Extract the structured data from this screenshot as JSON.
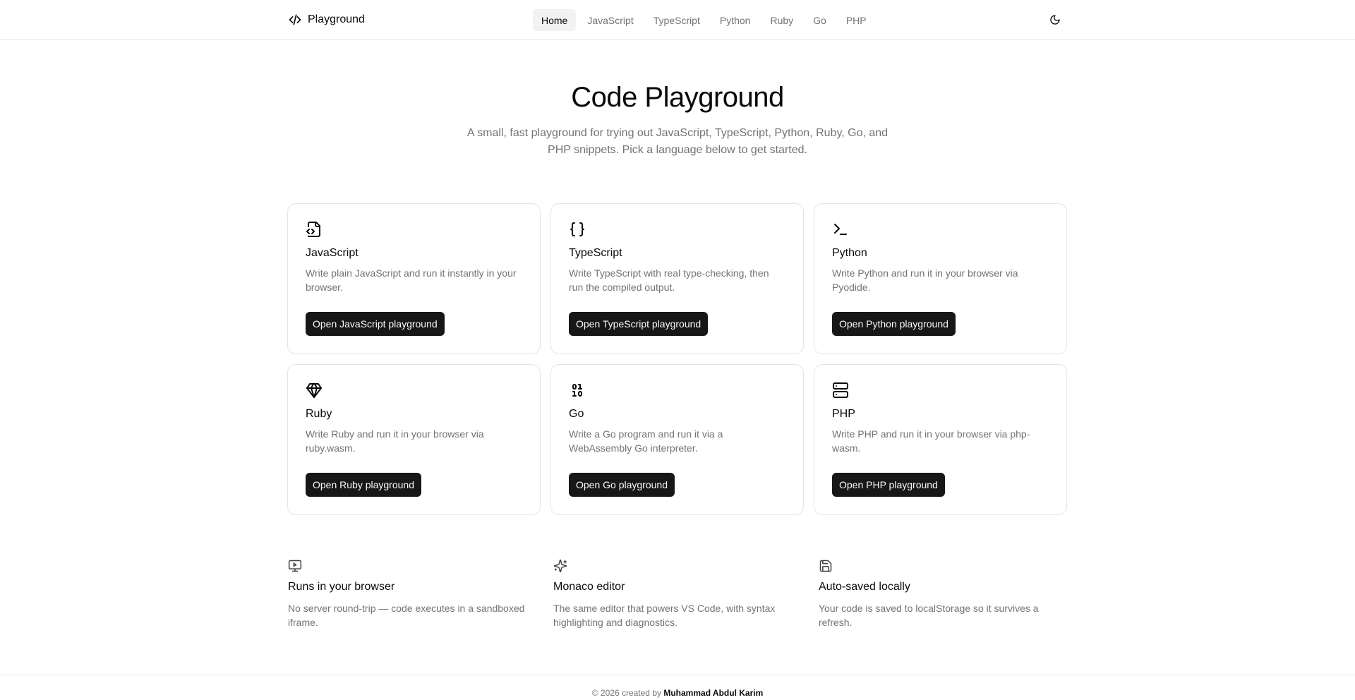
{
  "header": {
    "brand": "Playground",
    "nav": [
      "Home",
      "JavaScript",
      "TypeScript",
      "Python",
      "Ruby",
      "Go",
      "PHP"
    ],
    "active_nav": "Home"
  },
  "hero": {
    "title": "Code Playground",
    "subtitle": "A small, fast playground for trying out JavaScript, TypeScript, Python, Ruby, Go, and PHP snippets. Pick a language below to get started."
  },
  "cards": [
    {
      "icon": "file-code-icon",
      "title": "JavaScript",
      "description": "Write plain JavaScript and run it instantly in your browser.",
      "button": "Open JavaScript playground"
    },
    {
      "icon": "braces-icon",
      "title": "TypeScript",
      "description": "Write TypeScript with real type-checking, then run the compiled output.",
      "button": "Open TypeScript playground"
    },
    {
      "icon": "terminal-icon",
      "title": "Python",
      "description": "Write Python and run it in your browser via Pyodide.",
      "button": "Open Python playground"
    },
    {
      "icon": "gem-icon",
      "title": "Ruby",
      "description": "Write Ruby and run it in your browser via ruby.wasm.",
      "button": "Open Ruby playground"
    },
    {
      "icon": "binary-icon",
      "title": "Go",
      "description": "Write a Go program and run it via a WebAssembly Go interpreter.",
      "button": "Open Go playground"
    },
    {
      "icon": "server-icon",
      "title": "PHP",
      "description": "Write PHP and run it in your browser via php-wasm.",
      "button": "Open PHP playground"
    }
  ],
  "features": [
    {
      "icon": "monitor-play-icon",
      "title": "Runs in your browser",
      "description": "No server round-trip — code executes in a sandboxed iframe."
    },
    {
      "icon": "sparkles-icon",
      "title": "Monaco editor",
      "description": "The same editor that powers VS Code, with syntax highlighting and diagnostics."
    },
    {
      "icon": "save-icon",
      "title": "Auto-saved locally",
      "description": "Your code is saved to localStorage so it survives a refresh."
    }
  ],
  "footer": {
    "prefix": "© 2026 created by",
    "author": "Muhammad Abdul Karim"
  }
}
